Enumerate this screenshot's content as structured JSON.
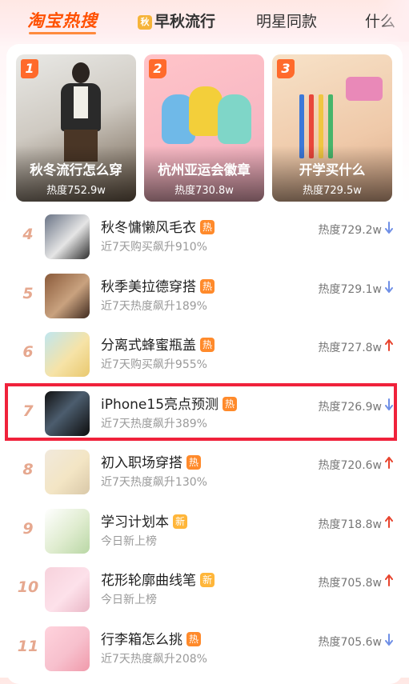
{
  "tabs": {
    "brand": "淘宝热搜",
    "autumn": "早秋流行",
    "star": "明星同款",
    "more": "什么",
    "autumn_icon": "leaf-icon"
  },
  "top_cards": [
    {
      "rank": "1",
      "title": "秋冬流行怎么穿",
      "heat": "热度752.9w"
    },
    {
      "rank": "2",
      "title": "杭州亚运会徽章",
      "heat": "热度730.8w"
    },
    {
      "rank": "3",
      "title": "开学买什么",
      "heat": "热度729.5w"
    }
  ],
  "list": [
    {
      "rank": "4",
      "title": "秋冬慵懒风毛衣",
      "badge": "热",
      "badge_type": "hot",
      "sub": "近7天购买飙升910%",
      "heat": "热度729.2w",
      "trend": "down"
    },
    {
      "rank": "5",
      "title": "秋季美拉德穿搭",
      "badge": "热",
      "badge_type": "hot",
      "sub": "近7天热度飙升189%",
      "heat": "热度729.1w",
      "trend": "down"
    },
    {
      "rank": "6",
      "title": "分离式蜂蜜瓶盖",
      "badge": "热",
      "badge_type": "hot",
      "sub": "近7天购买飙升955%",
      "heat": "热度727.8w",
      "trend": "up"
    },
    {
      "rank": "7",
      "title": "iPhone15亮点预测",
      "badge": "热",
      "badge_type": "hot",
      "sub": "近7天热度飙升389%",
      "heat": "热度726.9w",
      "trend": "down"
    },
    {
      "rank": "8",
      "title": "初入职场穿搭",
      "badge": "热",
      "badge_type": "hot",
      "sub": "近7天热度飙升130%",
      "heat": "热度720.6w",
      "trend": "up"
    },
    {
      "rank": "9",
      "title": "学习计划本",
      "badge": "新",
      "badge_type": "new",
      "sub": "今日新上榜",
      "heat": "热度718.8w",
      "trend": "up"
    },
    {
      "rank": "10",
      "title": "花形轮廓曲线笔",
      "badge": "新",
      "badge_type": "new",
      "sub": "今日新上榜",
      "heat": "热度705.8w",
      "trend": "up"
    },
    {
      "rank": "11",
      "title": "行李箱怎么挑",
      "badge": "热",
      "badge_type": "hot",
      "sub": "近7天热度飙升208%",
      "heat": "热度705.6w",
      "trend": "down"
    }
  ],
  "colors": {
    "brand": "#ff5000",
    "rank_number": "#e6a88f",
    "trend_up": "#e8442e",
    "trend_down": "#6f8fe6",
    "highlight": "#f0223b"
  }
}
